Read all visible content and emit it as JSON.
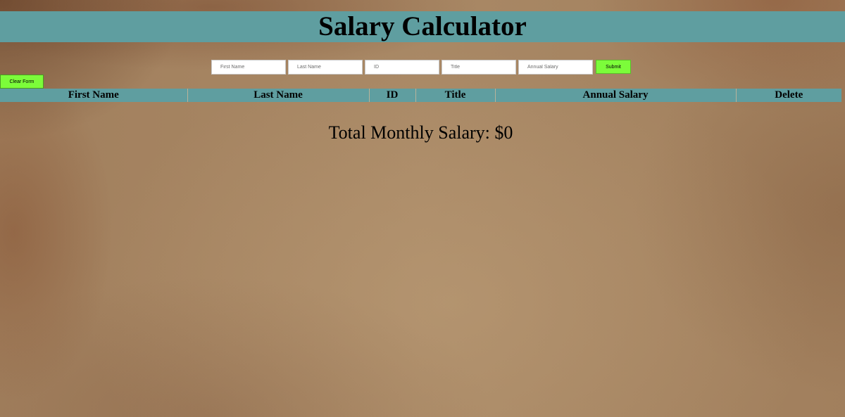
{
  "page": {
    "title": "Salary Calculator"
  },
  "form": {
    "first_name_placeholder": "First Name",
    "last_name_placeholder": "Last Name",
    "id_placeholder": "ID",
    "title_placeholder": "Title",
    "annual_salary_placeholder": "Annual Salary",
    "submit_label": "Submit",
    "clear_label": "Clear Form"
  },
  "table": {
    "headers": [
      "First Name",
      "Last Name",
      "ID",
      "Title",
      "Annual Salary",
      "Delete"
    ],
    "rows": []
  },
  "totals": {
    "label": "Total Monthly Salary: ",
    "value": "$0"
  },
  "colors": {
    "header_bg": "#5f9ea0",
    "button_bg": "#7cfc3a",
    "background": "#a58461"
  }
}
